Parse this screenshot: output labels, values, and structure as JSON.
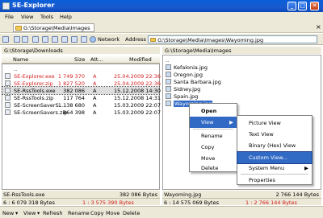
{
  "window": {
    "title": "SE-Explorer",
    "min": "_",
    "max": "□",
    "close": "✕"
  },
  "menu": [
    "File",
    "View",
    "Tools",
    "Help"
  ],
  "path_tab": "G:\\Storage\\Media\\Images",
  "tab_close": "×",
  "toolbar": {
    "network": "Network",
    "address_label": "Address",
    "address_value": "G:\\Storage\\Media\\Images\\Wayoming.jpg"
  },
  "left": {
    "path": "G:\\Storage\\Downloads",
    "columns": {
      "name": "Name",
      "size": "Size",
      "attr": "Att...",
      "modified": "Modified"
    },
    "up": "..",
    "rows": [
      {
        "name": "SE-Explorer.exe",
        "size": "1 749 370",
        "attr": "A",
        "modified": "25.04.2009 22:36",
        "red": true
      },
      {
        "name": "SE-Explorer.zip",
        "size": "1 827 520",
        "attr": "A",
        "modified": "25.04.2009 22:36",
        "red": true
      },
      {
        "name": "SE-RssTools.exe",
        "size": "382 086",
        "attr": "A",
        "modified": "15.12.2008 14:30",
        "red": false
      },
      {
        "name": "SE-RssTools.zip",
        "size": "117 764",
        "attr": "A",
        "modified": "15.12.2008 14:31",
        "red": false
      },
      {
        "name": "SE-ScreenSaverS...",
        "size": "1 138 680",
        "attr": "A",
        "modified": "15.03.2009 22:07",
        "red": false
      },
      {
        "name": "SE-ScreenSavers.zip",
        "size": "864 398",
        "attr": "A",
        "modified": "15.03.2009 22:07",
        "red": false
      }
    ],
    "status_name": "SE-RssTools.exe",
    "status_size": "382 086 Bytes",
    "status2_left": "6 : 6 079 318 Bytes",
    "status2_right": "1 : 3 575 390 Bytes"
  },
  "right": {
    "path": "G:\\Storage\\Media\\Images",
    "up": "..",
    "rows": [
      "Kefalonia.jpg",
      "Oregon.jpg",
      "Santa Barbara.jpg",
      "Sidney.jpg",
      "Spain.jpg",
      "Wayoming.jpg"
    ],
    "status_name": "Wayoming.jpg",
    "status_size": "2 766 144 Bytes",
    "status2_left": "6 : 14 575 069 Bytes",
    "status2_right": "1 : 2 766 144 Bytes"
  },
  "context_menu": [
    "Open",
    "View",
    "Rename",
    "Copy",
    "Move",
    "Delete"
  ],
  "view_submenu": [
    "Picture View",
    "Text View",
    "Binary (Hex) View",
    "Custom View...",
    "System Menu",
    "Properties"
  ],
  "bottom": [
    "New",
    "View",
    "Refresh",
    "Rename",
    "Copy",
    "Move",
    "Delete"
  ]
}
